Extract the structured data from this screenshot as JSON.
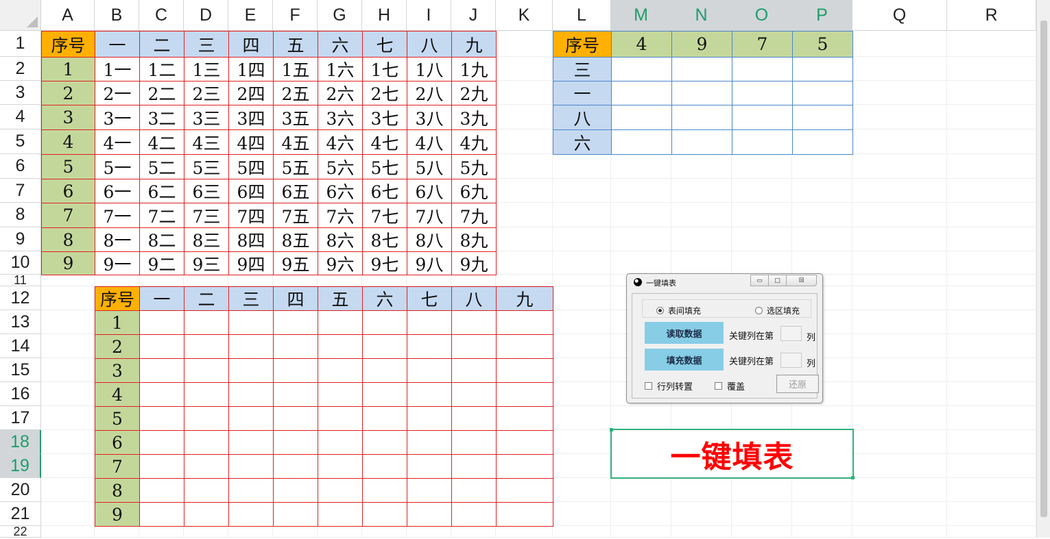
{
  "columns": [
    "A",
    "B",
    "C",
    "D",
    "E",
    "F",
    "G",
    "H",
    "I",
    "J",
    "K",
    "L",
    "M",
    "N",
    "O",
    "P",
    "Q",
    "R"
  ],
  "selected_columns": [
    "M",
    "N",
    "O",
    "P"
  ],
  "rows": [
    "1",
    "2",
    "3",
    "4",
    "5",
    "6",
    "7",
    "8",
    "9",
    "10",
    "11",
    "12",
    "13",
    "14",
    "15",
    "16",
    "17",
    "18",
    "19",
    "20",
    "21",
    "22"
  ],
  "selected_rows": [
    "18",
    "19"
  ],
  "table1": {
    "corner": "序号",
    "header": [
      "一",
      "二",
      "三",
      "四",
      "五",
      "六",
      "七",
      "八",
      "九"
    ],
    "index": [
      "1",
      "2",
      "3",
      "4",
      "5",
      "6",
      "7",
      "8",
      "9"
    ],
    "body": [
      [
        "1一",
        "1二",
        "1三",
        "1四",
        "1五",
        "1六",
        "1七",
        "1八",
        "1九"
      ],
      [
        "2一",
        "2二",
        "2三",
        "2四",
        "2五",
        "2六",
        "2七",
        "2八",
        "2九"
      ],
      [
        "3一",
        "3二",
        "3三",
        "3四",
        "3五",
        "3六",
        "3七",
        "3八",
        "3九"
      ],
      [
        "4一",
        "4二",
        "4三",
        "4四",
        "4五",
        "4六",
        "4七",
        "4八",
        "4九"
      ],
      [
        "5一",
        "5二",
        "5三",
        "5四",
        "5五",
        "5六",
        "5七",
        "5八",
        "5九"
      ],
      [
        "6一",
        "6二",
        "6三",
        "6四",
        "6五",
        "6六",
        "6七",
        "6八",
        "6九"
      ],
      [
        "7一",
        "7二",
        "7三",
        "7四",
        "7五",
        "7六",
        "7七",
        "7八",
        "7九"
      ],
      [
        "8一",
        "8二",
        "8三",
        "8四",
        "8五",
        "8六",
        "8七",
        "8八",
        "8九"
      ],
      [
        "9一",
        "9二",
        "9三",
        "9四",
        "9五",
        "9六",
        "9七",
        "9八",
        "9九"
      ]
    ]
  },
  "table2": {
    "corner": "序号",
    "header": [
      "一",
      "二",
      "三",
      "四",
      "五",
      "六",
      "七",
      "八",
      "九"
    ],
    "index": [
      "1",
      "2",
      "3",
      "4",
      "5",
      "6",
      "7",
      "8",
      "9"
    ]
  },
  "table3": {
    "corner": "序号",
    "header": [
      "4",
      "9",
      "7",
      "5"
    ],
    "index": [
      "三",
      "一",
      "八",
      "六"
    ]
  },
  "dialog": {
    "title": "一键填表",
    "minimize": "▭",
    "maximize": "□",
    "close": "☒",
    "radio_between": "表间填充",
    "radio_selection": "选区填充",
    "read_button": "读取数据",
    "fill_button": "填充数据",
    "key_col_label": "关键列在第",
    "key_col_unit": "列",
    "transpose_label": "行列转置",
    "overwrite_label": "覆盖",
    "restore_button": "还原"
  },
  "sheet_button": "一键填表"
}
